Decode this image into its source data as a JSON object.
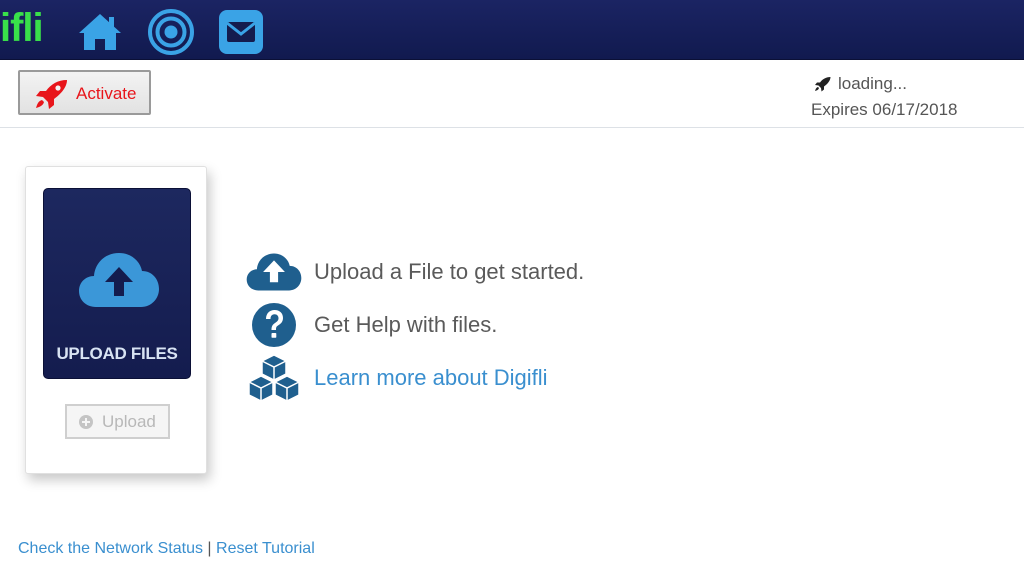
{
  "navbar": {
    "logo_text": "ifli",
    "icons": [
      "home-icon",
      "target-icon",
      "mail-icon"
    ],
    "brand_green": "#39e04a",
    "background": "#141c4e"
  },
  "subheader": {
    "activate_label": "Activate",
    "status_text": "loading...",
    "expires_text": "Expires 06/17/2018"
  },
  "upload_card": {
    "tile_label": "UPLOAD FILES",
    "upload_button_label": "Upload"
  },
  "info": [
    {
      "icon": "cloud-upload-icon",
      "text": "Upload a File to get started."
    },
    {
      "icon": "help-icon",
      "text": "Get Help with files."
    },
    {
      "icon": "cubes-icon",
      "text": "Learn more about Digifli"
    }
  ],
  "footer": {
    "network_link": "Check the Network Status",
    "separator": "|",
    "reset_link": "Reset Tutorial"
  },
  "colors": {
    "link": "#3a8fcf",
    "icon_blue": "#1f5f8e",
    "activate_red": "#e8151b"
  }
}
